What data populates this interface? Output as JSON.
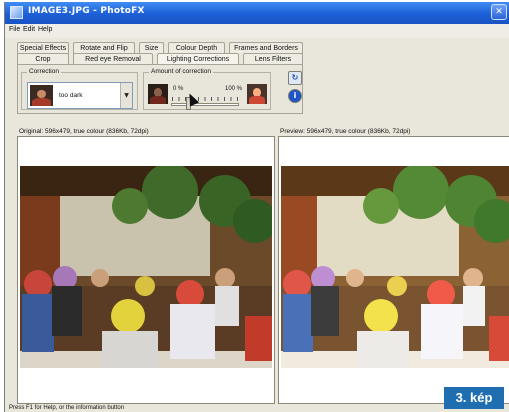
{
  "window": {
    "title": "IMAGE3.JPG - PhotoFX",
    "close_glyph": "✕"
  },
  "menu": [
    "File",
    "Edit",
    "Help"
  ],
  "tabs": {
    "row1": [
      "Special Effects",
      "Rotate and Flip",
      "Size",
      "Colour Depth",
      "Frames and Borders"
    ],
    "row2": [
      "Crop",
      "Red eye Removal",
      "Lighting Corrections",
      "Lens Filters"
    ],
    "active": "Lighting Corrections"
  },
  "correction": {
    "label": "Correction",
    "selected": "too dark"
  },
  "amount": {
    "label": "Amount of correction",
    "min_label": "0 %",
    "max_label": "100 %",
    "value_percent": 25
  },
  "side_buttons": {
    "undo_glyph": "↻",
    "info_glyph": "i"
  },
  "panes": {
    "original_caption": "Original: 596x479, true colour (836Kb, 72dpi)",
    "preview_caption": "Preview: 596x479, true colour (836Kb, 72dpi)"
  },
  "status": "Press F1 for Help, or the information button",
  "badge": "3. kép",
  "colors": {
    "titlebar": "#1d5fd6",
    "window": "#e9e6dc",
    "badge": "#1f6fb0"
  }
}
